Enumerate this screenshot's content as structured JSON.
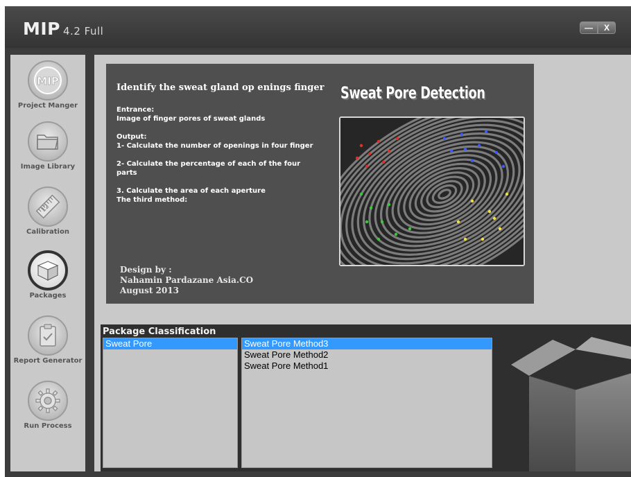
{
  "app": {
    "title": "MIP",
    "version": "4.2 Full"
  },
  "window_controls": {
    "minimize": "—",
    "close": "X"
  },
  "sidebar": {
    "items": [
      {
        "label": "Project Manger",
        "icon": "mip-logo-icon"
      },
      {
        "label": "Image Library",
        "icon": "folder-icon"
      },
      {
        "label": "Calibration",
        "icon": "ruler-icon"
      },
      {
        "label": "Packages",
        "icon": "box-icon",
        "active": true
      },
      {
        "label": "Report Generator",
        "icon": "clipboard-icon"
      },
      {
        "label": "Run Process",
        "icon": "gear-icon"
      }
    ]
  },
  "info": {
    "heading": "Identify the sweat gland op enings finger",
    "entrance_label": "Entrance:",
    "entrance_text": "Image of finger pores of sweat glands",
    "output_label": "Output:",
    "output_1": "1- Calculate the number of openings in four finger",
    "output_2": "2- Calculate the percentage of each of the four parts",
    "output_3": "3. Calculate the area of each aperture",
    "output_4": "The third method:",
    "design_by": "Design by :",
    "company": "Nahamin Pardazane Asia.CO",
    "date": "August 2013",
    "image_title": "Sweat Pore Detection"
  },
  "packages": {
    "title": "Package Classification",
    "categories": [
      "Sweat Pore"
    ],
    "selected_category": "Sweat Pore",
    "methods": [
      "Sweat Pore Method3",
      "Sweat Pore Method2",
      "Sweat Pore Method1"
    ],
    "selected_method": "Sweat Pore Method3"
  },
  "colors": {
    "selection": "#3399ff",
    "panel": "#4f4f4f",
    "sidebar": "#c9c9c9"
  }
}
